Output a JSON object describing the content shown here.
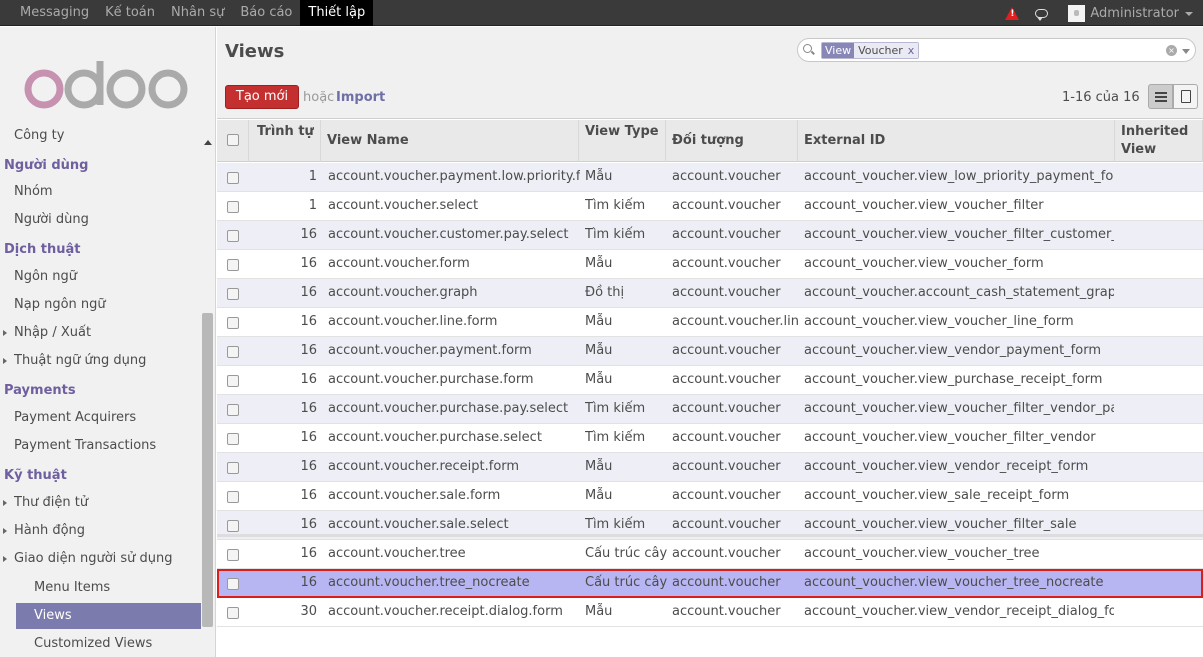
{
  "topbar": {
    "menu": [
      "Messaging",
      "Kế toán",
      "Nhân sự",
      "Báo cáo",
      "Thiết lập"
    ],
    "active_index": 4,
    "user": "Administrator"
  },
  "sidebar": {
    "logo": "odoo",
    "items": [
      {
        "label": "Công ty",
        "kind": "lvl1"
      },
      {
        "label": "Người dùng",
        "kind": "cat"
      },
      {
        "label": "Nhóm",
        "kind": "lvl1"
      },
      {
        "label": "Người dùng",
        "kind": "lvl1"
      },
      {
        "label": "Dịch thuật",
        "kind": "cat"
      },
      {
        "label": "Ngôn ngữ",
        "kind": "lvl1"
      },
      {
        "label": "Nạp ngôn ngữ",
        "kind": "lvl1"
      },
      {
        "label": "Nhập / Xuất",
        "kind": "lvl1",
        "expander": true
      },
      {
        "label": "Thuật ngữ ứng dụng",
        "kind": "lvl1",
        "expander": true
      },
      {
        "label": "Payments",
        "kind": "cat"
      },
      {
        "label": "Payment Acquirers",
        "kind": "lvl1"
      },
      {
        "label": "Payment Transactions",
        "kind": "lvl1"
      },
      {
        "label": "Kỹ thuật",
        "kind": "cat"
      },
      {
        "label": "Thư điện tử",
        "kind": "lvl1",
        "expander": true
      },
      {
        "label": "Hành động",
        "kind": "lvl1",
        "expander": true
      },
      {
        "label": "Giao diện người sử dụng",
        "kind": "lvl1",
        "expander": true
      },
      {
        "label": "Menu Items",
        "kind": "lvl2"
      },
      {
        "label": "Views",
        "kind": "lvl2",
        "selected": true
      },
      {
        "label": "Customized Views",
        "kind": "lvl2"
      }
    ]
  },
  "header": {
    "title": "Views",
    "search_facet_label": "View",
    "search_facet_value": "Voucher",
    "search_facet_remove": "x",
    "create_label": "Tạo mới",
    "or_label": "hoặc",
    "import_label": "Import",
    "pager": "1-16 của 16"
  },
  "grid": {
    "headers": [
      "Trình tự",
      "View Name",
      "View Type",
      "Đối tượng",
      "External ID",
      "Inherited View"
    ],
    "highlight_index": 14,
    "rows": [
      [
        "1",
        "account.voucher.payment.low.priority.form",
        "Mẫu",
        "account.voucher",
        "account_voucher.view_low_priority_payment_form"
      ],
      [
        "1",
        "account.voucher.select",
        "Tìm kiếm",
        "account.voucher",
        "account_voucher.view_voucher_filter"
      ],
      [
        "16",
        "account.voucher.customer.pay.select",
        "Tìm kiếm",
        "account.voucher",
        "account_voucher.view_voucher_filter_customer_pay"
      ],
      [
        "16",
        "account.voucher.form",
        "Mẫu",
        "account.voucher",
        "account_voucher.view_voucher_form"
      ],
      [
        "16",
        "account.voucher.graph",
        "Đồ thị",
        "account.voucher",
        "account_voucher.account_cash_statement_graph"
      ],
      [
        "16",
        "account.voucher.line.form",
        "Mẫu",
        "account.voucher.line",
        "account_voucher.view_voucher_line_form"
      ],
      [
        "16",
        "account.voucher.payment.form",
        "Mẫu",
        "account.voucher",
        "account_voucher.view_vendor_payment_form"
      ],
      [
        "16",
        "account.voucher.purchase.form",
        "Mẫu",
        "account.voucher",
        "account_voucher.view_purchase_receipt_form"
      ],
      [
        "16",
        "account.voucher.purchase.pay.select",
        "Tìm kiếm",
        "account.voucher",
        "account_voucher.view_voucher_filter_vendor_pay"
      ],
      [
        "16",
        "account.voucher.purchase.select",
        "Tìm kiếm",
        "account.voucher",
        "account_voucher.view_voucher_filter_vendor"
      ],
      [
        "16",
        "account.voucher.receipt.form",
        "Mẫu",
        "account.voucher",
        "account_voucher.view_vendor_receipt_form"
      ],
      [
        "16",
        "account.voucher.sale.form",
        "Mẫu",
        "account.voucher",
        "account_voucher.view_sale_receipt_form"
      ],
      [
        "16",
        "account.voucher.sale.select",
        "Tìm kiếm",
        "account.voucher",
        "account_voucher.view_voucher_filter_sale"
      ],
      [
        "16",
        "account.voucher.tree",
        "Cấu trúc cây",
        "account.voucher",
        "account_voucher.view_voucher_tree"
      ],
      [
        "16",
        "account.voucher.tree_nocreate",
        "Cấu trúc cây",
        "account.voucher",
        "account_voucher.view_voucher_tree_nocreate"
      ],
      [
        "30",
        "account.voucher.receipt.dialog.form",
        "Mẫu",
        "account.voucher",
        "account_voucher.view_vendor_receipt_dialog_form"
      ]
    ]
  },
  "colors": {
    "topbar": "#3a3a3a",
    "accent": "#7c7bad",
    "create_button": "#c42f2f",
    "highlight_row": "#b7b5f2",
    "highlight_border": "#dd1d1d"
  }
}
